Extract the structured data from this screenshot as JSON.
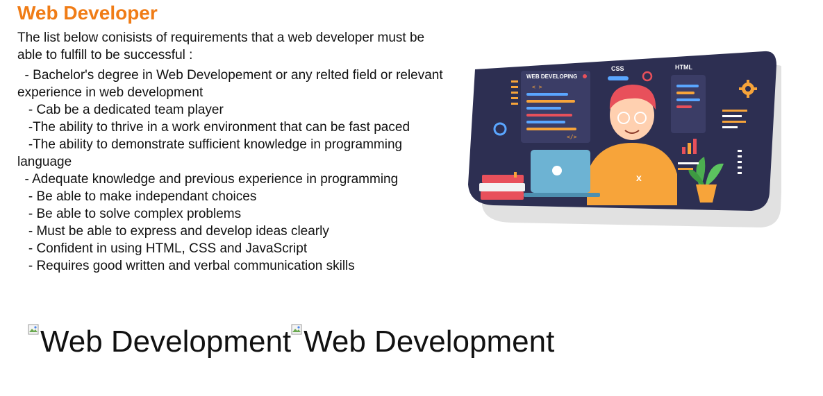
{
  "page": {
    "title": "Web Developer",
    "intro": "The list below conisists of requirements that a web developer must be able to fulfill to be successful :",
    "requirements": [
      "  - Bachelor's degree in Web Developement or any relted field or relevant experience in web development",
      "   - Cab be a dedicated team player",
      "   -The ability to thrive in a work environment that can be fast paced",
      "   -The ability to demonstrate sufficient knowledge in programming language",
      "  - Adequate knowledge and previous experience in programming",
      "   - Be able to make independant choices",
      "   - Be able to solve complex problems",
      "   - Must be able to express and develop ideas clearly",
      "   - Confident in using HTML, CSS and JavaScript",
      "   - Requires good written and verbal communication skills"
    ]
  },
  "illustration": {
    "panel_label": "WEB DEVELOPING",
    "css_label": "CSS",
    "html_label": "HTML",
    "tag_open": "< >",
    "tag_close": "</>",
    "icons": [
      "laptop-icon",
      "gear-icon",
      "plant-icon",
      "books-icon",
      "bar-chart-icon"
    ]
  },
  "broken_images": [
    {
      "alt": "Web Development"
    },
    {
      "alt": "Web Development"
    }
  ],
  "colors": {
    "title": "#f07c16",
    "screen_bg": "#2d2f52",
    "accent_orange": "#f7a43a",
    "accent_red": "#e8505b"
  }
}
